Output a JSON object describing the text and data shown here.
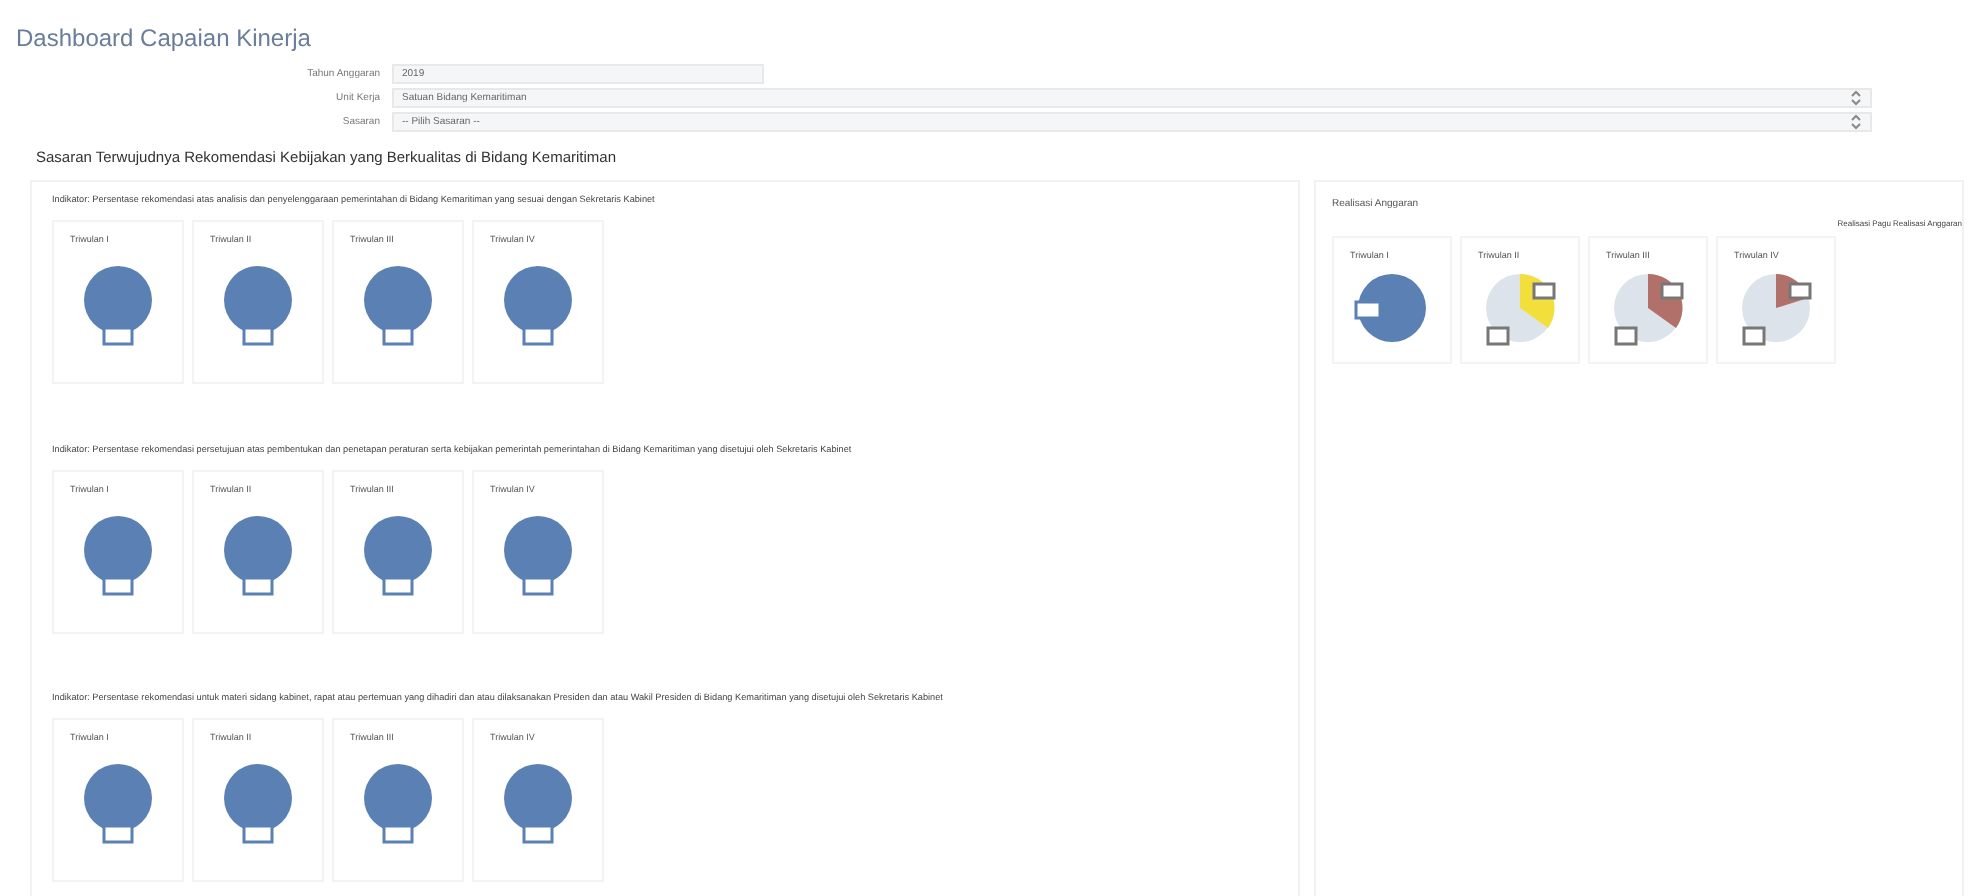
{
  "title": "Dashboard Capaian Kinerja",
  "filters": [
    {
      "label": "Tahun Anggaran",
      "value": "2019",
      "kind": "input"
    },
    {
      "label": "Unit Kerja",
      "value": "Satuan Bidang Kemaritiman",
      "kind": "select"
    },
    {
      "label": "Sasaran",
      "value": "-- Pilih Sasaran --",
      "kind": "select"
    }
  ],
  "goal_heading": "Sasaran Terwujudnya Rekomendasi Kebijakan yang Berkualitas di Bidang Kemaritiman",
  "indicators": [
    {
      "text": "Indikator: Persentase rekomendasi atas analisis dan penyelenggaraan pemerintahan di Bidang Kemaritiman yang sesuai dengan Sekretaris Kabinet",
      "cards": [
        {
          "label": "Triwulan I"
        },
        {
          "label": "Triwulan II"
        },
        {
          "label": "Triwulan III"
        },
        {
          "label": "Triwulan IV"
        }
      ]
    },
    {
      "text": "Indikator: Persentase rekomendasi persetujuan atas pembentukan dan penetapan peraturan serta kebijakan pemerintah pemerintahan di Bidang Kemaritiman yang disetujui oleh Sekretaris Kabinet",
      "cards": [
        {
          "label": "Triwulan I"
        },
        {
          "label": "Triwulan II"
        },
        {
          "label": "Triwulan III"
        },
        {
          "label": "Triwulan IV"
        }
      ]
    },
    {
      "text": "Indikator: Persentase rekomendasi untuk materi sidang kabinet, rapat atau pertemuan yang dihadiri dan atau dilaksanakan Presiden dan atau Wakil Presiden di Bidang Kemaritiman yang disetujui oleh Sekretaris Kabinet",
      "cards": [
        {
          "label": "Triwulan I"
        },
        {
          "label": "Triwulan II"
        },
        {
          "label": "Triwulan III"
        },
        {
          "label": "Triwulan IV"
        }
      ]
    }
  ],
  "budget": {
    "title": "Realisasi Anggaran",
    "legend": "Realisasi Pagu Realisasi Anggaran",
    "cards": [
      {
        "label": "Triwulan I",
        "kind": "full"
      },
      {
        "label": "Triwulan II",
        "kind": "half",
        "color": "#f3df3c"
      },
      {
        "label": "Triwulan III",
        "kind": "half",
        "color": "#b2706a"
      },
      {
        "label": "Triwulan IV",
        "kind": "quarter",
        "color": "#b2706a"
      }
    ]
  }
}
